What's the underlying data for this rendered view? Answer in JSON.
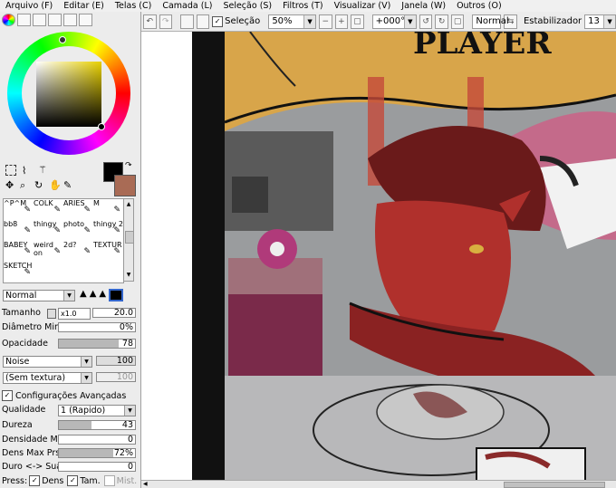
{
  "menu": [
    "Arquivo (F)",
    "Editar (E)",
    "Telas (C)",
    "Camada (L)",
    "Seleção (S)",
    "Filtros (T)",
    "Visualizar (V)",
    "Janela (W)",
    "Outros (O)"
  ],
  "toolbar": {
    "selection_label": "Seleção",
    "zoom": "50%",
    "rotation": "+000°",
    "blend_mode": "Normal",
    "stabilizer_label": "Estabilizador",
    "stabilizer_value": "13"
  },
  "brushes": [
    [
      "^P^M",
      "COLK",
      "ARIES",
      "M"
    ],
    [
      "bb8",
      "thingy",
      "photo",
      "thingy 2"
    ],
    [
      "BABEY",
      "weird on",
      "2d?",
      "TEXTUR"
    ],
    [
      "SKETCH",
      "",
      "",
      ""
    ]
  ],
  "brush_settings": {
    "mode": "Normal",
    "size_label": "Tamanho",
    "size_mult": "x1.0",
    "size_value": "20.0",
    "min_diam_label": "Diâmetro Min.",
    "min_diam_value": "0%",
    "opacity_label": "Opacidade",
    "opacity_value": "78",
    "texture1": "Noise",
    "texture1_value": "100",
    "texture2": "(Sem textura)",
    "texture2_value": "100",
    "advanced_label": "Configurações Avançadas",
    "quality_label": "Qualidade",
    "quality_value": "1 (Rapido)",
    "hardness_label": "Dureza",
    "hardness_value": "43",
    "min_density_label": "Densidade Min.",
    "min_density_value": "0",
    "max_dens_label": "Dens Max Prs.",
    "max_dens_value": "72%",
    "hard_soft_label": "Duro <-> Suave",
    "hard_soft_value": "0",
    "press_label": "Press:",
    "dens_label": "Dens",
    "tam_label": "Tam.",
    "mist_label": "Mist."
  },
  "canvas_text": "PLAYER",
  "colors": {
    "primary": "#000000",
    "secondary": "#a96b55"
  }
}
